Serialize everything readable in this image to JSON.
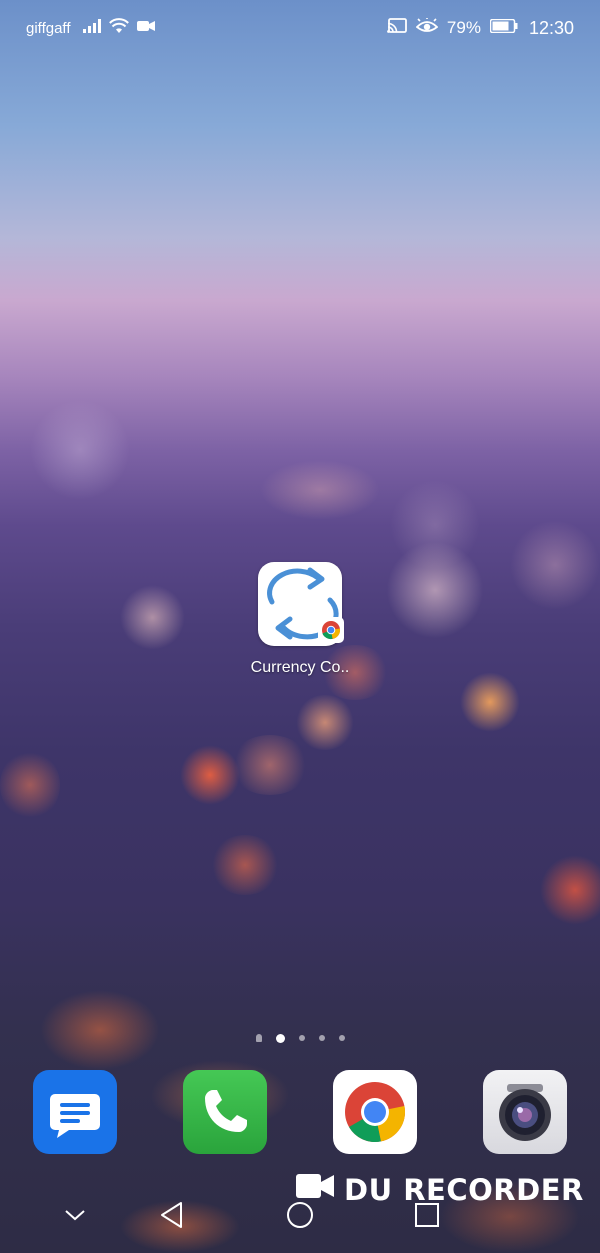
{
  "status_bar": {
    "carrier": "giffgaff",
    "battery_percent": "79%",
    "time": "12:30",
    "icons": [
      "signal-icon",
      "wifi-icon",
      "video-camera-icon",
      "cast-icon",
      "eye-comfort-icon",
      "battery-icon"
    ]
  },
  "home": {
    "app": {
      "label": "Currency Co..",
      "icon": "currency-converter-icon",
      "badge": "chrome-badge-icon"
    },
    "pages": {
      "count": 4,
      "current": 1
    }
  },
  "dock": {
    "apps": [
      {
        "name": "Messages",
        "icon": "messages-icon"
      },
      {
        "name": "Phone",
        "icon": "phone-icon"
      },
      {
        "name": "Chrome",
        "icon": "chrome-icon"
      },
      {
        "name": "Camera",
        "icon": "camera-icon"
      }
    ]
  },
  "watermark": {
    "text": "DU RECORDER",
    "icon": "video-camera-icon"
  },
  "nav_bar": {
    "buttons": [
      "hide-nav-icon",
      "back-icon",
      "home-icon",
      "recents-icon"
    ]
  },
  "colors": {
    "messages_blue": "#1a73e8",
    "phone_green": "#35b44a",
    "arrow_blue": "#4a90d6"
  }
}
